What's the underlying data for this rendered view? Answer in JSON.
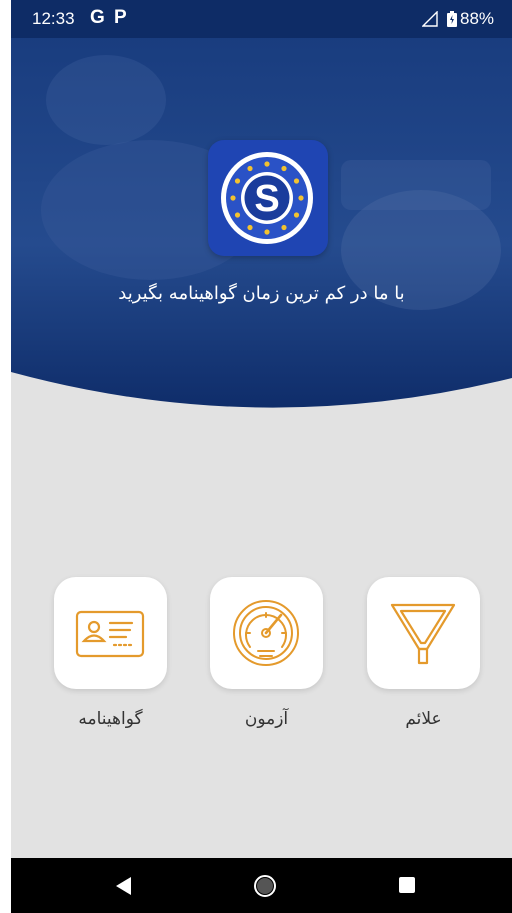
{
  "status_bar": {
    "time": "12:33",
    "icon_g": "G",
    "icon_p": "P",
    "battery": "88%"
  },
  "hero": {
    "logo_letter": "S",
    "tagline": "با ما در کم ترین زمان گواهینامه بگیرید"
  },
  "menu": [
    {
      "label": "گواهینامه",
      "icon": "license-card-icon"
    },
    {
      "label": "آزمون",
      "icon": "speedometer-icon"
    },
    {
      "label": "علائم",
      "icon": "yield-sign-icon"
    }
  ],
  "colors": {
    "primary_blue": "#0e2c66",
    "accent_orange": "#e49a2c",
    "background": "#e2e2e2",
    "logo_blue": "#1f45b3"
  }
}
